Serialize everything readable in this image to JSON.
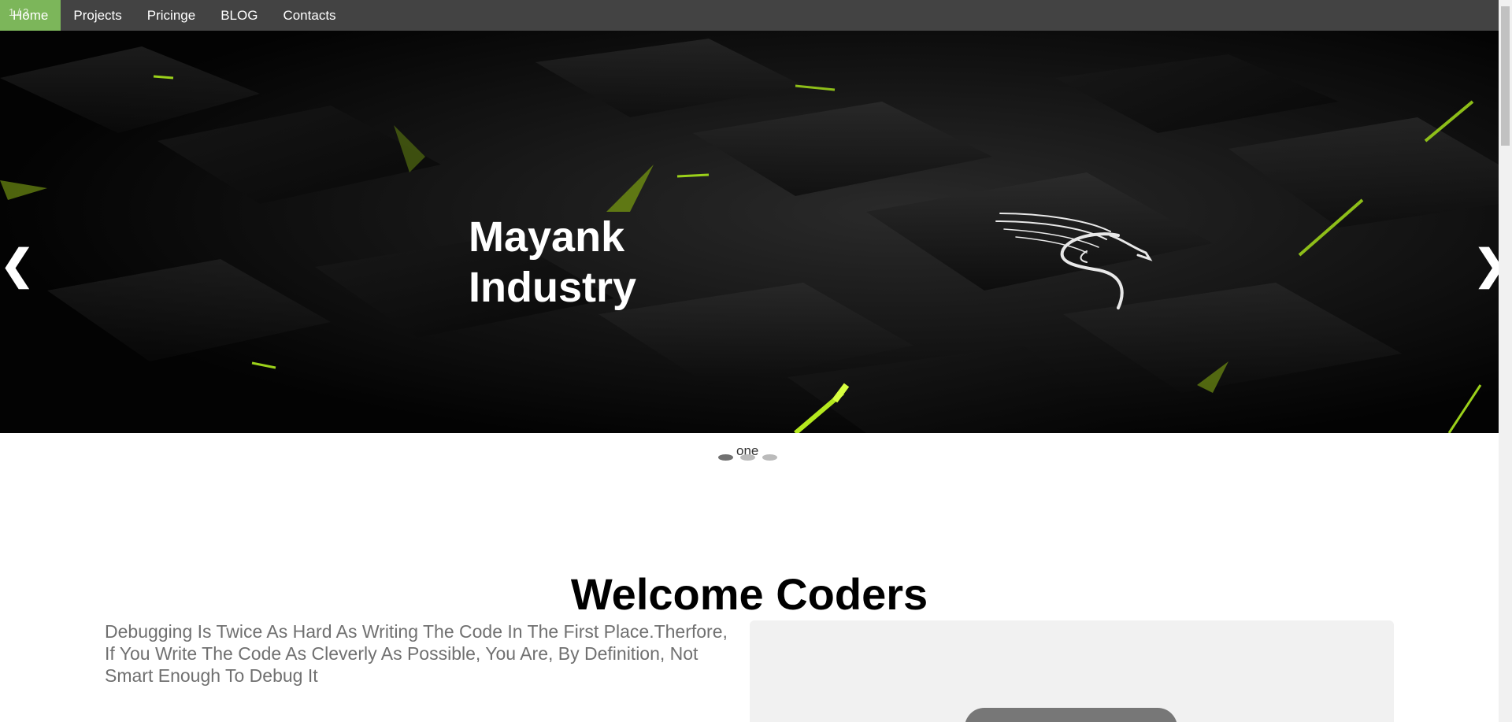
{
  "nav": {
    "slide_counter": "1 / 3",
    "items": [
      {
        "label": "Home",
        "active": true
      },
      {
        "label": "Projects"
      },
      {
        "label": "Pricinge"
      },
      {
        "label": "BLOG"
      },
      {
        "label": "Contacts"
      }
    ],
    "bar_color": "#434343",
    "active_color": "#7cb65a"
  },
  "hero": {
    "title_line1": "Mayank",
    "title_line2": "Industry",
    "prev_arrow": "❮",
    "next_arrow": "❯",
    "logo_icon": "kali-dragon-icon",
    "accent_color": "#9bd11a"
  },
  "slider": {
    "caption": "one",
    "dots_count": 3,
    "active_dot": 1
  },
  "welcome": {
    "heading": "Welcome Coders",
    "quote": "Debugging Is Twice As Hard As Writing The Code In The First Place.Therfore, If You Write The Code As Cleverly As Possible, You Are, By Definition, Not Smart Enough To Debug It"
  }
}
